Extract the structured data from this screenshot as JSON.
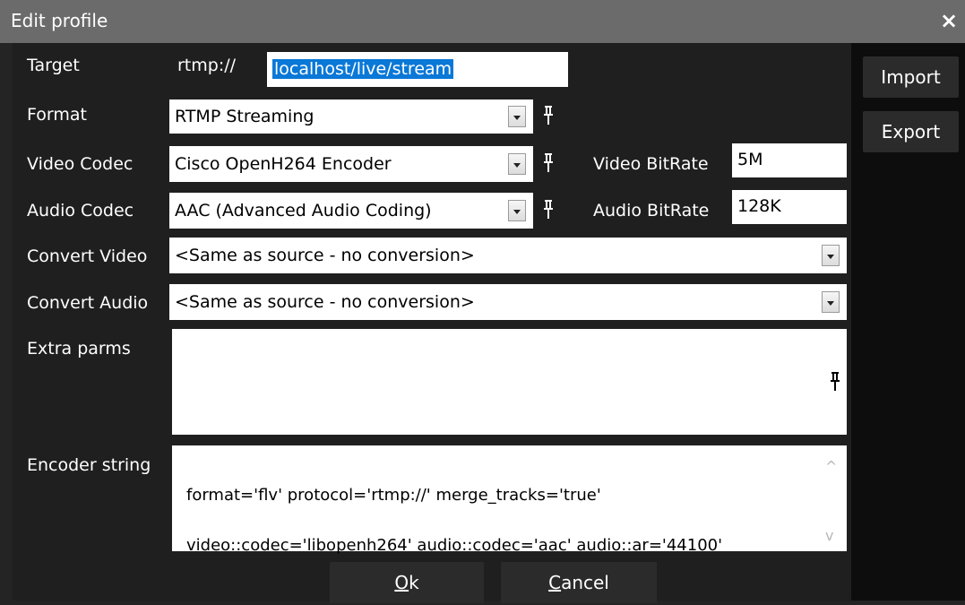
{
  "window": {
    "title": "Edit profile",
    "close_icon": "×"
  },
  "labels": {
    "target": "Target",
    "target_prefix": "rtmp://",
    "format": "Format",
    "video_codec": "Video Codec",
    "audio_codec": "Audio Codec",
    "video_bitrate": "Video BitRate",
    "audio_bitrate": "Audio BitRate",
    "convert_video": "Convert Video",
    "convert_audio": "Convert Audio",
    "extra_parms": "Extra parms",
    "encoder_string": "Encoder string"
  },
  "fields": {
    "target_value": "localhost/live/stream",
    "format_value": "RTMP Streaming",
    "video_codec_value": "Cisco OpenH264 Encoder",
    "audio_codec_value": "AAC (Advanced Audio Coding)",
    "video_bitrate_value": "5M",
    "audio_bitrate_value": "128K",
    "convert_video_value": "<Same as source - no conversion>",
    "convert_audio_value": "<Same as source - no conversion>",
    "extra_parms_value": "",
    "encoder_string_line1": "format='flv' protocol='rtmp://' merge_tracks='true'",
    "encoder_string_line2": "video::codec='libopenh264' audio::codec='aac' audio::ar='44100'"
  },
  "buttons": {
    "import": "Import",
    "export": "Export",
    "ok_mnemonic": "O",
    "ok_rest": "k",
    "cancel_mnemonic": "C",
    "cancel_rest": "ancel"
  },
  "icons": {
    "pin": "pin-icon",
    "dropdown": "chevron-down-icon",
    "scroll_up": "^",
    "scroll_down": "v"
  },
  "colors": {
    "titlebar": "#6b6b6b",
    "dialog_bg": "#1f1f1f",
    "side_panel": "#0d0d0d",
    "selection": "#0a78d7",
    "button": "#2b2b2b"
  }
}
